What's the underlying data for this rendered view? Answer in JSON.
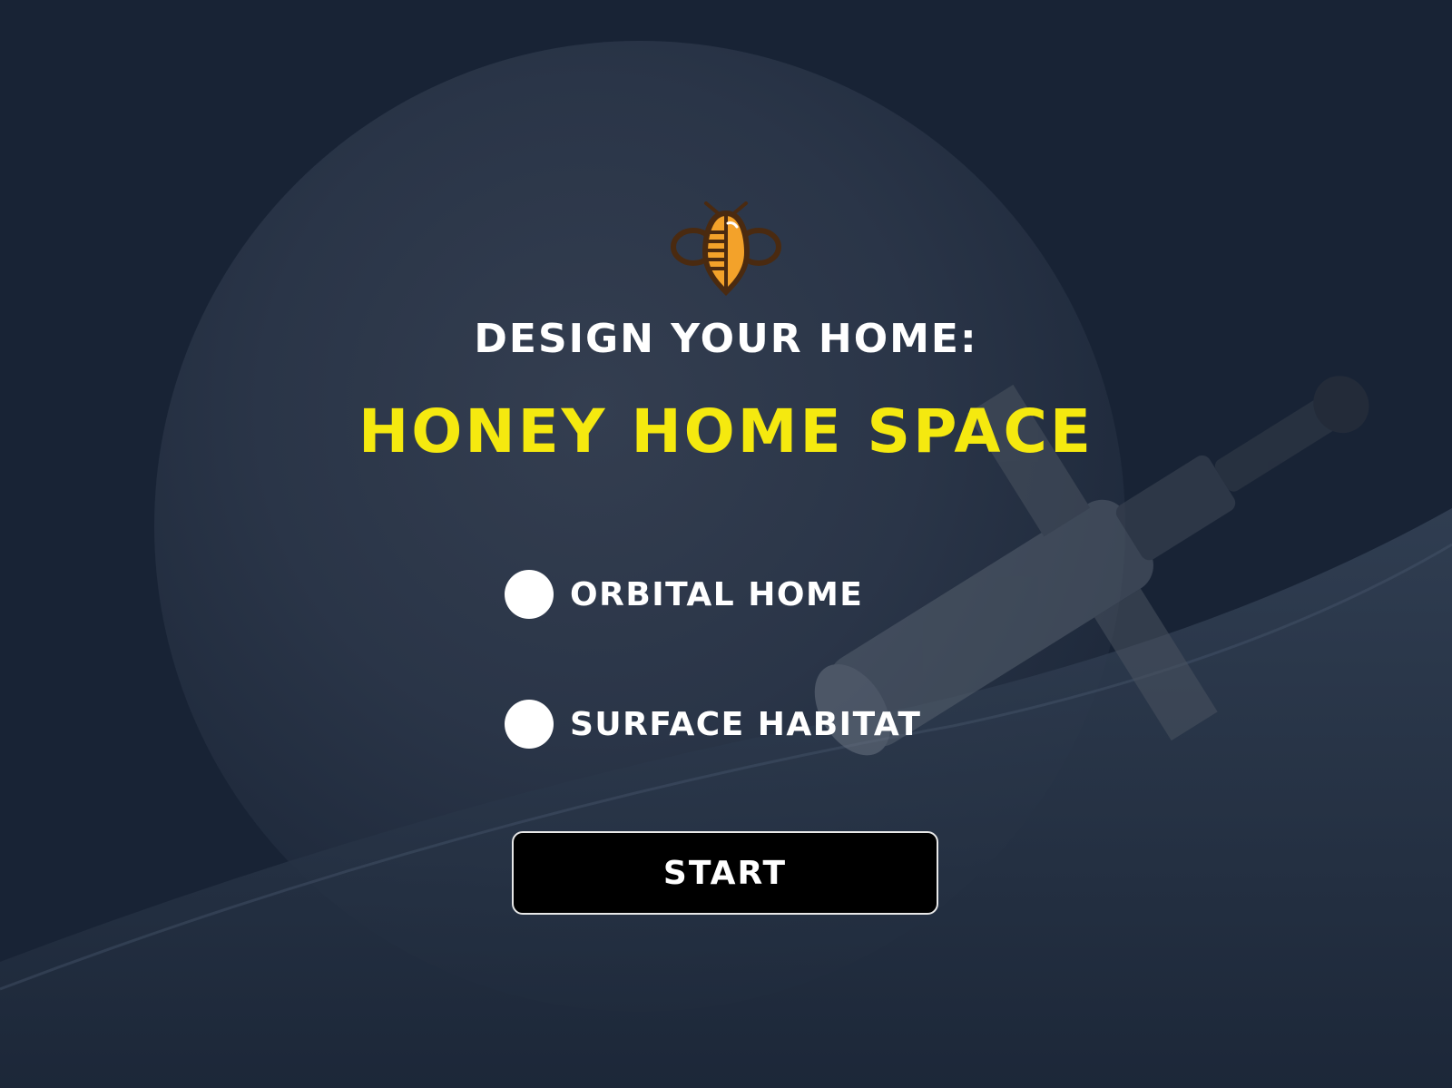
{
  "screen": {
    "subtitle": "DESIGN YOUR HOME:",
    "title": "HONEY HOME SPACE"
  },
  "logo": {
    "icon": "bee-icon"
  },
  "options": [
    {
      "label": "ORBITAL HOME",
      "selected": false
    },
    {
      "label": "SURFACE HABITAT",
      "selected": false
    }
  ],
  "start_button": {
    "label": "START"
  },
  "colors": {
    "background": "#192437",
    "title": "#f5e90f",
    "text": "#ffffff",
    "button": "#000000",
    "logo_body": "#f3a22a",
    "logo_outline": "#4a2a10"
  }
}
